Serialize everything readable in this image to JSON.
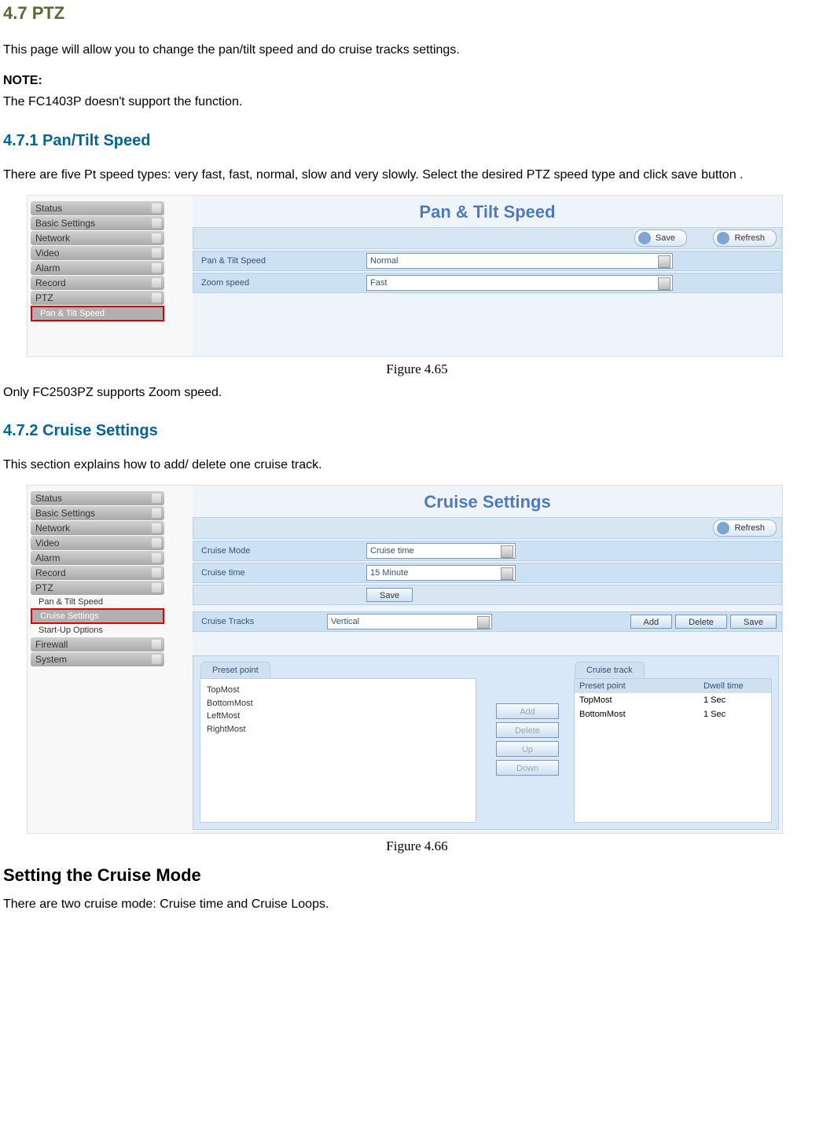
{
  "headings": {
    "h_main": "4.7  PTZ",
    "h_471": "4.7.1  Pan/Tilt Speed",
    "h_472": "4.7.2  Cruise Settings",
    "h_setting_mode": "Setting the Cruise Mode"
  },
  "paragraphs": {
    "intro": "This page will allow you to change the pan/tilt speed and do cruise tracks settings.",
    "note_label": "NOTE:",
    "note_body": "The FC1403P doesn't support the function.",
    "pt_speed": "There are five Pt speed types: very fast, fast, normal, slow and very slowly. Select the desired PTZ speed type and click save button .",
    "only_zoom": "Only FC2503PZ supports Zoom speed.",
    "cruise_intro": "This section explains how to add/ delete one cruise track.",
    "cruise_mode_body": "There are two cruise mode: Cruise time and Cruise Loops."
  },
  "captions": {
    "fig65": "Figure 4.65",
    "fig66": "Figure 4.66"
  },
  "sidebar_items": [
    "Status",
    "Basic Settings",
    "Network",
    "Video",
    "Alarm",
    "Record",
    "PTZ"
  ],
  "sidebar_sub_pantilt": "Pan & Tilt Speed",
  "sidebar_sub_cruise": "Cruise Settings",
  "sidebar_sub_startup": "Start-Up Options",
  "sidebar_extra": [
    "Firewall",
    "System"
  ],
  "fig1": {
    "title": "Pan & Tilt Speed",
    "save": "Save",
    "refresh": "Refresh",
    "row1_label": "Pan & Tilt Speed",
    "row1_value": "Normal",
    "row2_label": "Zoom speed",
    "row2_value": "Fast"
  },
  "fig2": {
    "title": "Cruise Settings",
    "refresh": "Refresh",
    "r1_label": "Cruise Mode",
    "r1_value": "Cruise time",
    "r2_label": "Cruise time",
    "r2_value": "15 Minute",
    "save": "Save",
    "r3_label": "Cruise Tracks",
    "r3_value": "Vertical",
    "add": "Add",
    "delete": "Delete",
    "save2": "Save",
    "preset_tab": "Preset point",
    "presets": [
      "TopMost",
      "BottomMost",
      "LeftMost",
      "RightMost"
    ],
    "mid": {
      "add": "Add",
      "delete": "Delete",
      "up": "Up",
      "down": "Down"
    },
    "track_tab": "Cruise track",
    "track_head_preset": "Preset point",
    "track_head_dwell": "Dwell time",
    "track_rows": [
      {
        "preset": "TopMost",
        "dwell": "1 Sec"
      },
      {
        "preset": "BottomMost",
        "dwell": "1 Sec"
      }
    ]
  }
}
